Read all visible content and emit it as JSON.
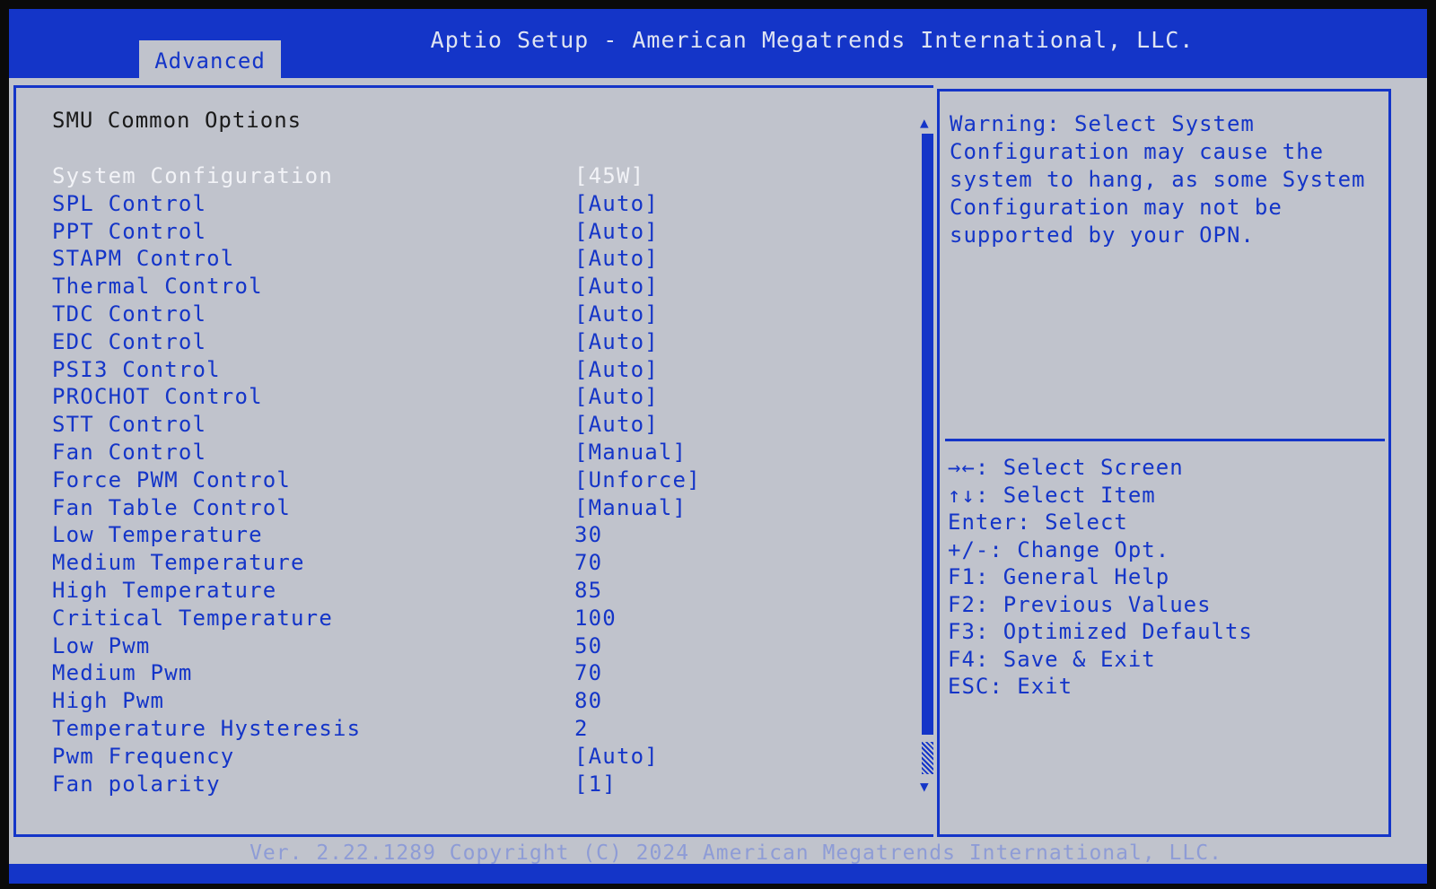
{
  "window": {
    "title": "Aptio Setup - American Megatrends International, LLC.",
    "footer": "Ver. 2.22.1289 Copyright (C) 2024 American Megatrends International, LLC."
  },
  "tabs": [
    {
      "label": "Advanced"
    }
  ],
  "section": {
    "title": "SMU Common Options"
  },
  "settings": [
    {
      "label": "System Configuration",
      "value": "[45W]"
    },
    {
      "label": "SPL Control",
      "value": "[Auto]"
    },
    {
      "label": "PPT Control",
      "value": "[Auto]"
    },
    {
      "label": "STAPM Control",
      "value": "[Auto]"
    },
    {
      "label": "Thermal Control",
      "value": "[Auto]"
    },
    {
      "label": "TDC Control",
      "value": "[Auto]"
    },
    {
      "label": "EDC Control",
      "value": "[Auto]"
    },
    {
      "label": "PSI3 Control",
      "value": "[Auto]"
    },
    {
      "label": "PROCHOT Control",
      "value": "[Auto]"
    },
    {
      "label": "STT Control",
      "value": "[Auto]"
    },
    {
      "label": "Fan Control",
      "value": "[Manual]"
    },
    {
      "label": "Force PWM Control",
      "value": "[Unforce]"
    },
    {
      "label": "Fan Table Control",
      "value": "[Manual]"
    },
    {
      "label": "Low Temperature",
      "value": "30"
    },
    {
      "label": "Medium Temperature",
      "value": "70"
    },
    {
      "label": "High Temperature",
      "value": "85"
    },
    {
      "label": "Critical Temperature",
      "value": "100"
    },
    {
      "label": "Low Pwm",
      "value": "50"
    },
    {
      "label": "Medium Pwm",
      "value": "70"
    },
    {
      "label": "High Pwm",
      "value": "80"
    },
    {
      "label": "Temperature Hysteresis",
      "value": "2"
    },
    {
      "label": "Pwm Frequency",
      "value": "[Auto]"
    },
    {
      "label": "Fan polarity",
      "value": "[1]"
    }
  ],
  "help": {
    "text": "Warning: Select System Configuration may cause the system to hang, as some System Configuration may not be supported by your OPN."
  },
  "keys": [
    "→←: Select Screen",
    "↑↓: Select Item",
    "Enter: Select",
    "+/-: Change Opt.",
    "F1: General Help",
    "F2: Previous Values",
    "F3: Optimized Defaults",
    "F4: Save & Exit",
    "ESC: Exit"
  ],
  "colors": {
    "primary_blue": "#1435c8",
    "panel_gray": "#c0c3cc",
    "selected_text": "#f2f3f7"
  },
  "selected_index": 0,
  "scroll": {
    "up_icon": "▲",
    "down_icon": "▼"
  }
}
